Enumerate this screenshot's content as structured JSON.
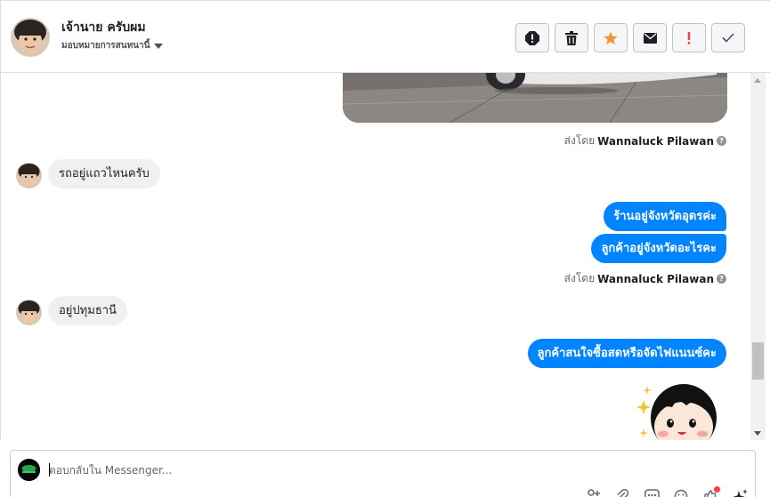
{
  "header": {
    "contact_name": "เจ้านาย ครับผม",
    "assign_label": "มอบหมายการสนทนานี้"
  },
  "actions": [
    {
      "name": "spam-icon",
      "color": "#1c1e21"
    },
    {
      "name": "trash-icon",
      "color": "#1c1e21"
    },
    {
      "name": "star-icon",
      "color": "#f7923b"
    },
    {
      "name": "mail-icon",
      "color": "#1c1e21"
    },
    {
      "name": "important-icon",
      "color": "#fa3e3e"
    },
    {
      "name": "check-icon",
      "color": "#4b4f56"
    }
  ],
  "messages": {
    "sent_by_prefix": "ส่งโดย",
    "sent_by_name": "Wannaluck Pilawan",
    "incoming_1": "รถอยู่แถวไหนครับ",
    "outgoing_1": "ร้านอยู่จังหวัดอุดรค่ะ",
    "outgoing_2": "ลูกค้าอยู่จังหวัดอะไรคะ",
    "incoming_2": "อยู่ปทุมธานี",
    "outgoing_3": "ลูกค้าสนใจซื้อสดหรือจัดไฟแนนซ์คะ"
  },
  "composer": {
    "placeholder": "ตอบกลับใน Messenger...",
    "value": ""
  },
  "colors": {
    "accent": "#0084ff",
    "bubble_in": "#f1f0f0"
  }
}
